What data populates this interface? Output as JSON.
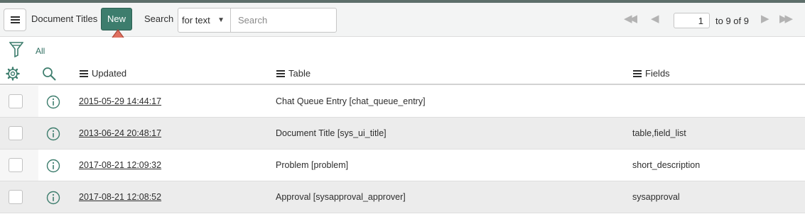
{
  "toolbar": {
    "title": "Document Titles",
    "new_label": "New",
    "search_label": "Search",
    "search_field_select": "for text",
    "search_placeholder": "Search",
    "page_number": "1",
    "page_range_text": "to 9 of 9"
  },
  "filter": {
    "breadcrumb": "All"
  },
  "icons": {
    "menu": "hamburger-menu-icon",
    "filter": "funnel-icon",
    "settings": "gear-icon",
    "search": "magnifier-icon",
    "info": "info-circle-icon",
    "pager": [
      "first-page-icon",
      "previous-page-icon",
      "next-page-icon",
      "last-page-icon"
    ],
    "annotation": "red-arrow-pointing-up"
  },
  "colors": {
    "accent": "#3d7d6d",
    "annotation_arrow": "#e07060"
  },
  "table": {
    "columns": [
      "Updated",
      "Table",
      "Fields"
    ],
    "rows": [
      {
        "updated": "2015-05-29 14:44:17",
        "table": "Chat Queue Entry [chat_queue_entry]",
        "fields": ""
      },
      {
        "updated": "2013-06-24 20:48:17",
        "table": "Document Title [sys_ui_title]",
        "fields": "table,field_list"
      },
      {
        "updated": "2017-08-21 12:09:32",
        "table": "Problem [problem]",
        "fields": "short_description"
      },
      {
        "updated": "2017-08-21 12:08:52",
        "table": "Approval [sysapproval_approver]",
        "fields": "sysapproval"
      }
    ]
  }
}
